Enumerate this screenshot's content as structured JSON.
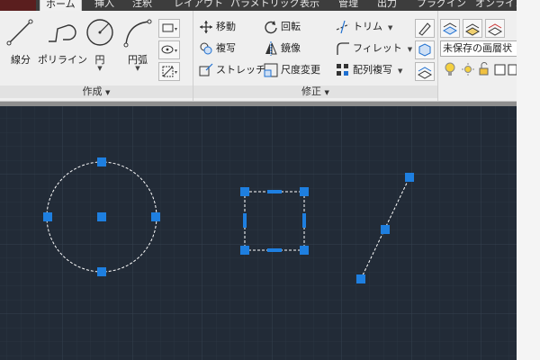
{
  "tabs": [
    {
      "label": "ホーム",
      "active": true
    },
    {
      "label": "挿入"
    },
    {
      "label": "注釈"
    },
    {
      "label": "レイアウト"
    },
    {
      "label": "パラメトリック"
    },
    {
      "label": "表示"
    },
    {
      "label": "管理"
    },
    {
      "label": "出力"
    },
    {
      "label": "プラグイン"
    },
    {
      "label": "オンライン"
    }
  ],
  "ribbon": {
    "create": {
      "title": "作成",
      "tools": [
        {
          "label": "線分",
          "icon": "line-icon"
        },
        {
          "label": "ポリライン",
          "icon": "polyline-icon"
        },
        {
          "label": "円",
          "icon": "circle-icon"
        },
        {
          "label": "円弧",
          "icon": "arc-icon"
        }
      ]
    },
    "modify": {
      "title": "修正",
      "tools": [
        {
          "label": "移動",
          "icon": "move-icon"
        },
        {
          "label": "回転",
          "icon": "rotate-icon"
        },
        {
          "label": "トリム",
          "icon": "trim-icon"
        },
        {
          "label": "複写",
          "icon": "copy-icon"
        },
        {
          "label": "鏡像",
          "icon": "mirror-icon"
        },
        {
          "label": "フィレット",
          "icon": "fillet-icon"
        },
        {
          "label": "ストレッチ",
          "icon": "stretch-icon"
        },
        {
          "label": "尺度変更",
          "icon": "scale-icon"
        },
        {
          "label": "配列複写",
          "icon": "array-icon"
        }
      ]
    },
    "layer": {
      "current_layer": "未保存の画層状"
    }
  },
  "colors": {
    "canvas_bg": "#222b37",
    "grip": "#1e7fe0",
    "accent": "#3d3d3d"
  }
}
